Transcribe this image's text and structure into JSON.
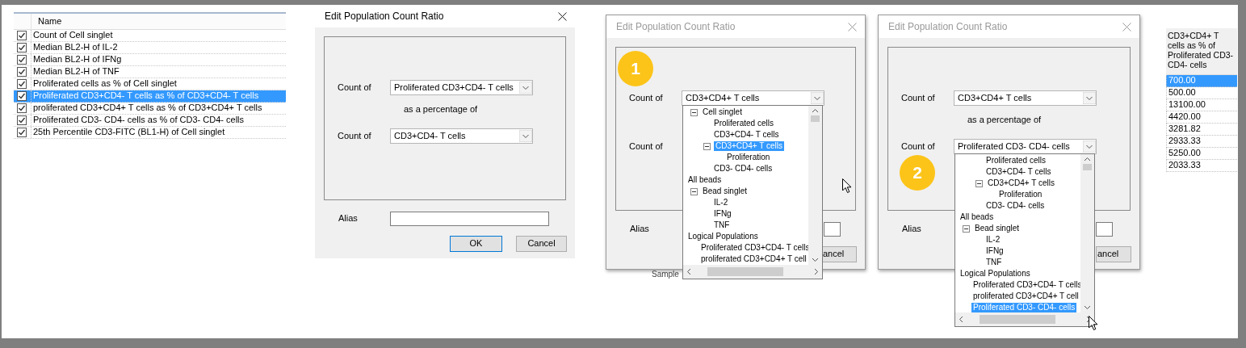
{
  "measure_list": {
    "header": "Name",
    "rows": [
      {
        "label": "Count of Cell singlet",
        "checked": true,
        "selected": false
      },
      {
        "label": "Median BL2-H of IL-2",
        "checked": true,
        "selected": false
      },
      {
        "label": "Median BL2-H of IFNg",
        "checked": true,
        "selected": false
      },
      {
        "label": "Median BL2-H of TNF",
        "checked": true,
        "selected": false
      },
      {
        "label": "Proliferated cells as % of Cell singlet",
        "checked": true,
        "selected": false
      },
      {
        "label": "Proliferated CD3+CD4- T cells as % of CD3+CD4- T cells",
        "checked": true,
        "selected": true
      },
      {
        "label": "proliferated CD3+CD4+ T cells as % of CD3+CD4+ T cells",
        "checked": true,
        "selected": false
      },
      {
        "label": "Proliferated CD3- CD4- cells as % of CD3- CD4- cells",
        "checked": true,
        "selected": false
      },
      {
        "label": "25th Percentile CD3-FITC (BL1-H) of Cell singlet",
        "checked": true,
        "selected": false
      }
    ]
  },
  "dialogs": [
    {
      "title": "Edit Population Count Ratio",
      "active": true,
      "first_label": "Count of",
      "first_combo": "Proliferated CD3+CD4- T cells",
      "percentage_text": "as a percentage of",
      "second_label": "Count of",
      "second_combo": "CD3+CD4- T cells",
      "alias_label": "Alias",
      "ok_button": "OK",
      "cancel_button": "Cancel"
    },
    {
      "title": "Edit Population Count Ratio",
      "active": false,
      "step_badge": "1",
      "first_label": "Count of",
      "first_combo": "CD3+CD4+ T cells",
      "second_label": "Count of",
      "alias_label": "Alias",
      "cancel_button": "ancel",
      "below_text": "Sample",
      "first_dropdown": {
        "tree": [
          {
            "children": [
              {
                "label": "Cell singlet",
                "expanded": true,
                "selected": false,
                "children": [
                  {
                    "label": "Proliferated cells",
                    "selected": false
                  },
                  {
                    "label": "CD3+CD4- T cells",
                    "selected": false
                  },
                  {
                    "label": "CD3+CD4+ T cells",
                    "expanded": true,
                    "selected": true,
                    "children": [
                      {
                        "label": "Proliferation",
                        "selected": false
                      }
                    ]
                  },
                  {
                    "label": "CD3- CD4- cells",
                    "selected": false
                  }
                ]
              }
            ]
          },
          {
            "label": "All beads",
            "selected": false,
            "children": [
              {
                "label": "Bead singlet",
                "expanded": true,
                "selected": false,
                "children": [
                  {
                    "label": "IL-2",
                    "selected": false
                  },
                  {
                    "label": "IFNg",
                    "selected": false
                  },
                  {
                    "label": "TNF",
                    "selected": false
                  }
                ]
              }
            ]
          },
          {
            "label": "Logical Populations",
            "selected": false,
            "children": [
              {
                "label": "Proliferated CD3+CD4- T cells",
                "selected": false
              },
              {
                "label": "proliferated CD3+CD4+ T cell",
                "selected": false
              }
            ]
          }
        ]
      }
    },
    {
      "title": "Edit Population Count Ratio",
      "active": false,
      "step_badge": "2",
      "first_label": "Count of",
      "first_combo": "CD3+CD4+ T cells",
      "percentage_text": "as a percentage of",
      "second_label": "Count of",
      "second_combo": "Proliferated CD3- CD4- cells",
      "alias_label": "Alias",
      "cancel_button": "ancel",
      "second_dropdown": {
        "tree": [
          {
            "children": [
              {
                "children": [
                  {
                    "label": "Proliferated cells",
                    "selected": false
                  },
                  {
                    "label": "CD3+CD4- T cells",
                    "selected": false
                  },
                  {
                    "label": "CD3+CD4+ T cells",
                    "expanded": true,
                    "selected": false,
                    "children": [
                      {
                        "label": "Proliferation",
                        "selected": false
                      }
                    ]
                  },
                  {
                    "label": "CD3- CD4- cells",
                    "selected": false
                  }
                ]
              }
            ]
          },
          {
            "label": "All beads",
            "selected": false,
            "children": [
              {
                "label": "Bead singlet",
                "expanded": true,
                "selected": false,
                "children": [
                  {
                    "label": "IL-2",
                    "selected": false
                  },
                  {
                    "label": "IFNg",
                    "selected": false
                  },
                  {
                    "label": "TNF",
                    "selected": false
                  }
                ]
              }
            ]
          },
          {
            "label": "Logical Populations",
            "selected": false,
            "children": [
              {
                "label": "Proliferated CD3+CD4- T cells",
                "selected": false
              },
              {
                "label": "proliferated CD3+CD4+ T cell",
                "selected": false
              },
              {
                "label": "Proliferated CD3- CD4- cells",
                "selected": true
              }
            ]
          }
        ]
      }
    }
  ],
  "result_column": {
    "header": "CD3+CD4+ T cells as % of Proliferated CD3- CD4- cells",
    "rows": [
      {
        "value": "700.00",
        "selected": true
      },
      {
        "value": "500.00",
        "selected": false
      },
      {
        "value": "13100.00",
        "selected": false
      },
      {
        "value": "4420.00",
        "selected": false
      },
      {
        "value": "3281.82",
        "selected": false
      },
      {
        "value": "2933.33",
        "selected": false
      },
      {
        "value": "5250.00",
        "selected": false
      },
      {
        "value": "2033.33",
        "selected": false
      }
    ]
  }
}
